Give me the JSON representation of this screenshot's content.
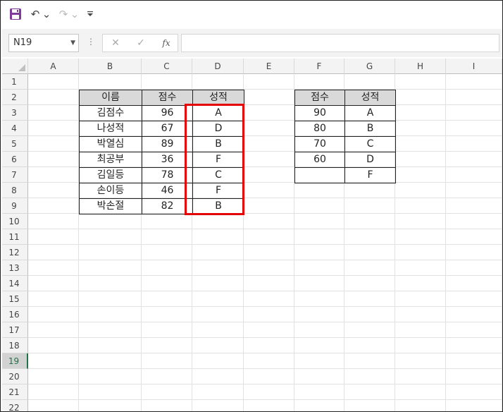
{
  "toolbar": {
    "save_icon": "save-icon",
    "undo_icon": "undo-icon",
    "redo_icon": "redo-icon",
    "more_icon": "customize-toolbar-icon"
  },
  "formula_bar": {
    "name_box": "N19",
    "fx_label": "fx",
    "formula": ""
  },
  "columns": [
    "A",
    "B",
    "C",
    "D",
    "E",
    "F",
    "G",
    "H",
    "I"
  ],
  "rows": [
    "1",
    "2",
    "3",
    "4",
    "5",
    "6",
    "7",
    "8",
    "9",
    "10",
    "11",
    "12",
    "13",
    "14",
    "15",
    "16",
    "17",
    "18",
    "19",
    "20",
    "21",
    "22"
  ],
  "selected_row": "19",
  "left_table": {
    "headers": [
      "이름",
      "점수",
      "성적"
    ],
    "rows": [
      [
        "김점수",
        "96",
        "A"
      ],
      [
        "나성적",
        "67",
        "D"
      ],
      [
        "박열심",
        "89",
        "B"
      ],
      [
        "최공부",
        "36",
        "F"
      ],
      [
        "김일등",
        "78",
        "C"
      ],
      [
        "손이등",
        "46",
        "F"
      ],
      [
        "박손절",
        "82",
        "B"
      ]
    ]
  },
  "right_table": {
    "headers": [
      "점수",
      "성적"
    ],
    "rows": [
      [
        "90",
        "A"
      ],
      [
        "80",
        "B"
      ],
      [
        "70",
        "C"
      ],
      [
        "60",
        "D"
      ],
      [
        "",
        "F"
      ]
    ]
  },
  "colors": {
    "highlight": "#e30000",
    "header_fill": "#d9d9d9",
    "selection_accent": "#217346"
  }
}
